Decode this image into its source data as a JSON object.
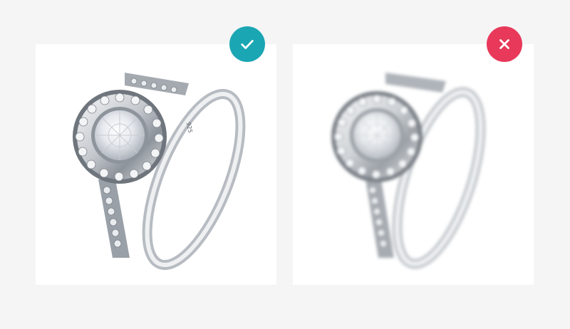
{
  "comparison": {
    "left": {
      "status": "good",
      "icon": "check-icon",
      "badge_color": "#1ba6b3",
      "image": "ring-sharp-image"
    },
    "right": {
      "status": "bad",
      "icon": "close-icon",
      "badge_color": "#e8395a",
      "image": "ring-blurred-image"
    }
  },
  "ring": {
    "engraving": "925"
  }
}
